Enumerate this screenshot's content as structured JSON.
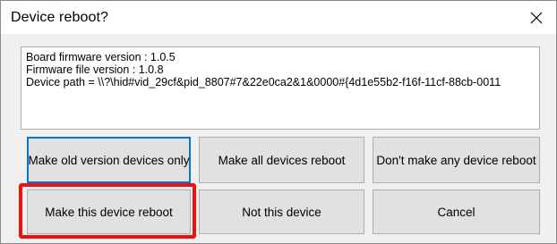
{
  "dialog": {
    "title": "Device reboot?",
    "close_icon": "close-icon"
  },
  "info": {
    "lines": [
      "Board firmware version : 1.0.5",
      "Firmware file version : 1.0.8",
      "Device path = \\\\?\\hid#vid_29cf&pid_8807#7&22e0ca2&1&0000#{4d1e55b2-f16f-11cf-88cb-0011"
    ]
  },
  "buttons": {
    "old_version_only": "Make old version devices only",
    "all_reboot": "Make all devices reboot",
    "none_reboot": "Don't make any device reboot",
    "this_reboot": "Make this device reboot",
    "not_this": "Not this device",
    "cancel": "Cancel"
  },
  "colors": {
    "highlight": "#ee1111",
    "focus": "#0078d7"
  }
}
